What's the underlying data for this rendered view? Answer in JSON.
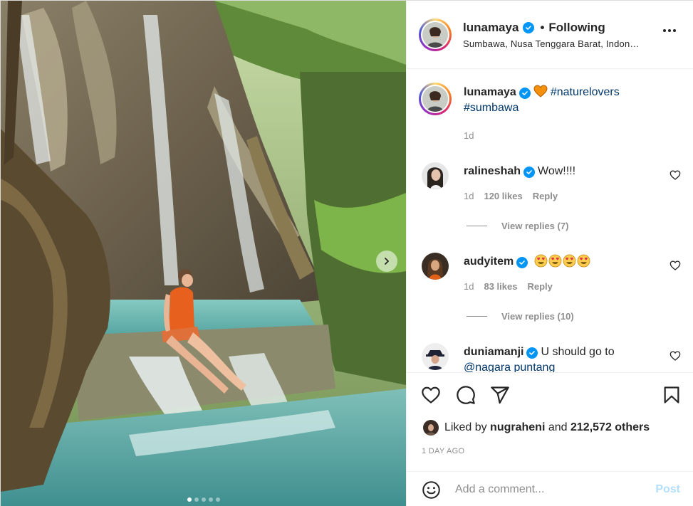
{
  "post": {
    "username": "lunamaya",
    "follow_status": "Following",
    "separator": "•",
    "location": "Sumbawa, Nusa Tenggara Barat, Indon…",
    "media": {
      "description_icon": "waterfall-photo",
      "slide_count": 5,
      "active_slide_fraction": 0.2
    }
  },
  "caption": {
    "username": "lunamaya",
    "emoji": "orange-heart",
    "hashtags": [
      "#naturelovers",
      "#sumbawa"
    ],
    "time": "1d"
  },
  "comments": [
    {
      "username": "ralineshah",
      "verified": true,
      "text": "Wow!!!!",
      "time": "1d",
      "likes": "120 likes",
      "reply": "Reply",
      "view_replies": "View replies (7)"
    },
    {
      "username": "audyitem",
      "verified": true,
      "text": "",
      "emojis": [
        "heart-eyes",
        "heart-eyes",
        "heart-eyes",
        "heart-eyes"
      ],
      "time": "1d",
      "likes": "83 likes",
      "reply": "Reply",
      "view_replies": "View replies (10)"
    },
    {
      "username": "duniamanji",
      "verified": true,
      "text": "U should go to",
      "text_second_line": "@nagara puntang",
      "time": "",
      "likes": "",
      "reply": ""
    }
  ],
  "actions": {
    "liked_by_prefix": "Liked by",
    "liked_by_user": "nugraheni",
    "liked_by_and": "and",
    "liked_by_count": "212,572 others",
    "post_age": "1 DAY AGO"
  },
  "add_comment": {
    "placeholder": "Add a comment...",
    "post_label": "Post"
  },
  "colors": {
    "verified": "#0095f6",
    "hashtag": "#00376b",
    "secondary_text": "#8e8e8e",
    "post_button_disabled": "#b2dffc"
  }
}
